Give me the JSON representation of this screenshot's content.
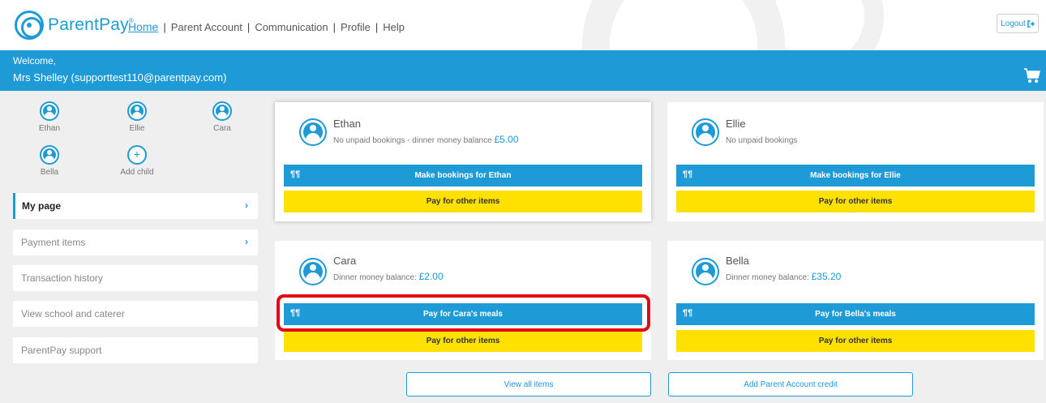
{
  "header": {
    "logo_text": "ParentPay",
    "logo_mark": "®",
    "nav": [
      {
        "label": "Home"
      },
      {
        "label": "Parent Account"
      },
      {
        "label": "Communication"
      },
      {
        "label": "Profile"
      },
      {
        "label": "Help"
      }
    ],
    "separator": "|",
    "logout_label": "Logout"
  },
  "welcome": {
    "line1": "Welcome,",
    "line2": "Mrs Shelley (supporttest110@parentpay.com)"
  },
  "children": [
    {
      "name": "Ethan"
    },
    {
      "name": "Ellie"
    },
    {
      "name": "Cara"
    },
    {
      "name": "Bella"
    },
    {
      "name": "Add child"
    }
  ],
  "menu": [
    {
      "label": "My page",
      "chevron": "›"
    },
    {
      "label": "Payment items",
      "chevron": "›"
    },
    {
      "label": "Transaction history"
    },
    {
      "label": "View school and caterer"
    },
    {
      "label": "ParentPay support"
    }
  ],
  "cards": [
    {
      "name": "Ethan",
      "info_prefix": "No unpaid bookings - dinner money balance ",
      "amount": "£5.00",
      "primary_label": "Make bookings for Ethan",
      "secondary_label": "Pay for other items"
    },
    {
      "name": "Ellie",
      "info_prefix": "No unpaid bookings",
      "amount": "",
      "primary_label": "Make bookings for Ellie",
      "secondary_label": "Pay for other items"
    },
    {
      "name": "Cara",
      "info_prefix": "Dinner money balance: ",
      "amount": "£2.00",
      "primary_label": "Pay for Cara's meals",
      "secondary_label": "Pay for other items"
    },
    {
      "name": "Bella",
      "info_prefix": "Dinner money balance: ",
      "amount": "£35.20",
      "primary_label": "Pay for Bella's meals",
      "secondary_label": "Pay for other items"
    }
  ],
  "bottom": {
    "view_all_label": "View all items",
    "add_credit_label": "Add Parent Account credit"
  },
  "colors": {
    "brand_blue": "#1e9ad6",
    "yellow": "#ffe100",
    "highlight_red": "#e30613"
  },
  "icons": {
    "cutlery": "fork-knife-icon",
    "cart": "cart-icon",
    "logout": "logout-icon"
  }
}
